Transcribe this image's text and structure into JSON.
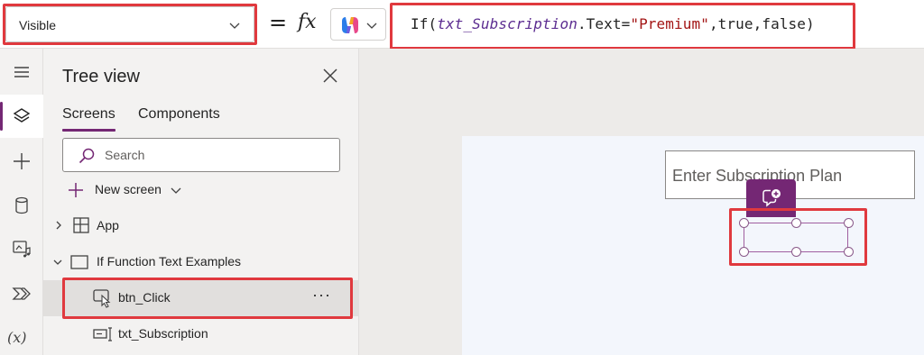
{
  "formula_bar": {
    "property": "Visible",
    "equals": "=",
    "fx": "fx",
    "formula": {
      "prefix": "If(",
      "control": "txt_Subscription",
      "middle": ".Text=",
      "string": "\"Premium\"",
      "suffix": ",true,false)"
    },
    "copilot_icon": "copilot-icon"
  },
  "rail": {
    "items": [
      "hamburger-icon",
      "layers-icon",
      "plus-icon",
      "database-icon",
      "media-icon",
      "connectors-icon",
      "variables-icon"
    ],
    "variables_label": "(x)"
  },
  "tree": {
    "title": "Tree view",
    "tabs": [
      {
        "label": "Screens",
        "active": true
      },
      {
        "label": "Components",
        "active": false
      }
    ],
    "search_placeholder": "Search",
    "new_screen_label": "New screen",
    "nodes": {
      "app": "App",
      "screen": "If Function Text Examples",
      "button": "btn_Click",
      "text_input": "txt_Subscription"
    },
    "more_label": "···"
  },
  "canvas": {
    "text_input_placeholder": "Enter Subscription Plan"
  },
  "colors": {
    "accent": "#742774",
    "highlight": "#e0393e",
    "panel": "#f3f2f1",
    "canvas": "#edebe9"
  }
}
